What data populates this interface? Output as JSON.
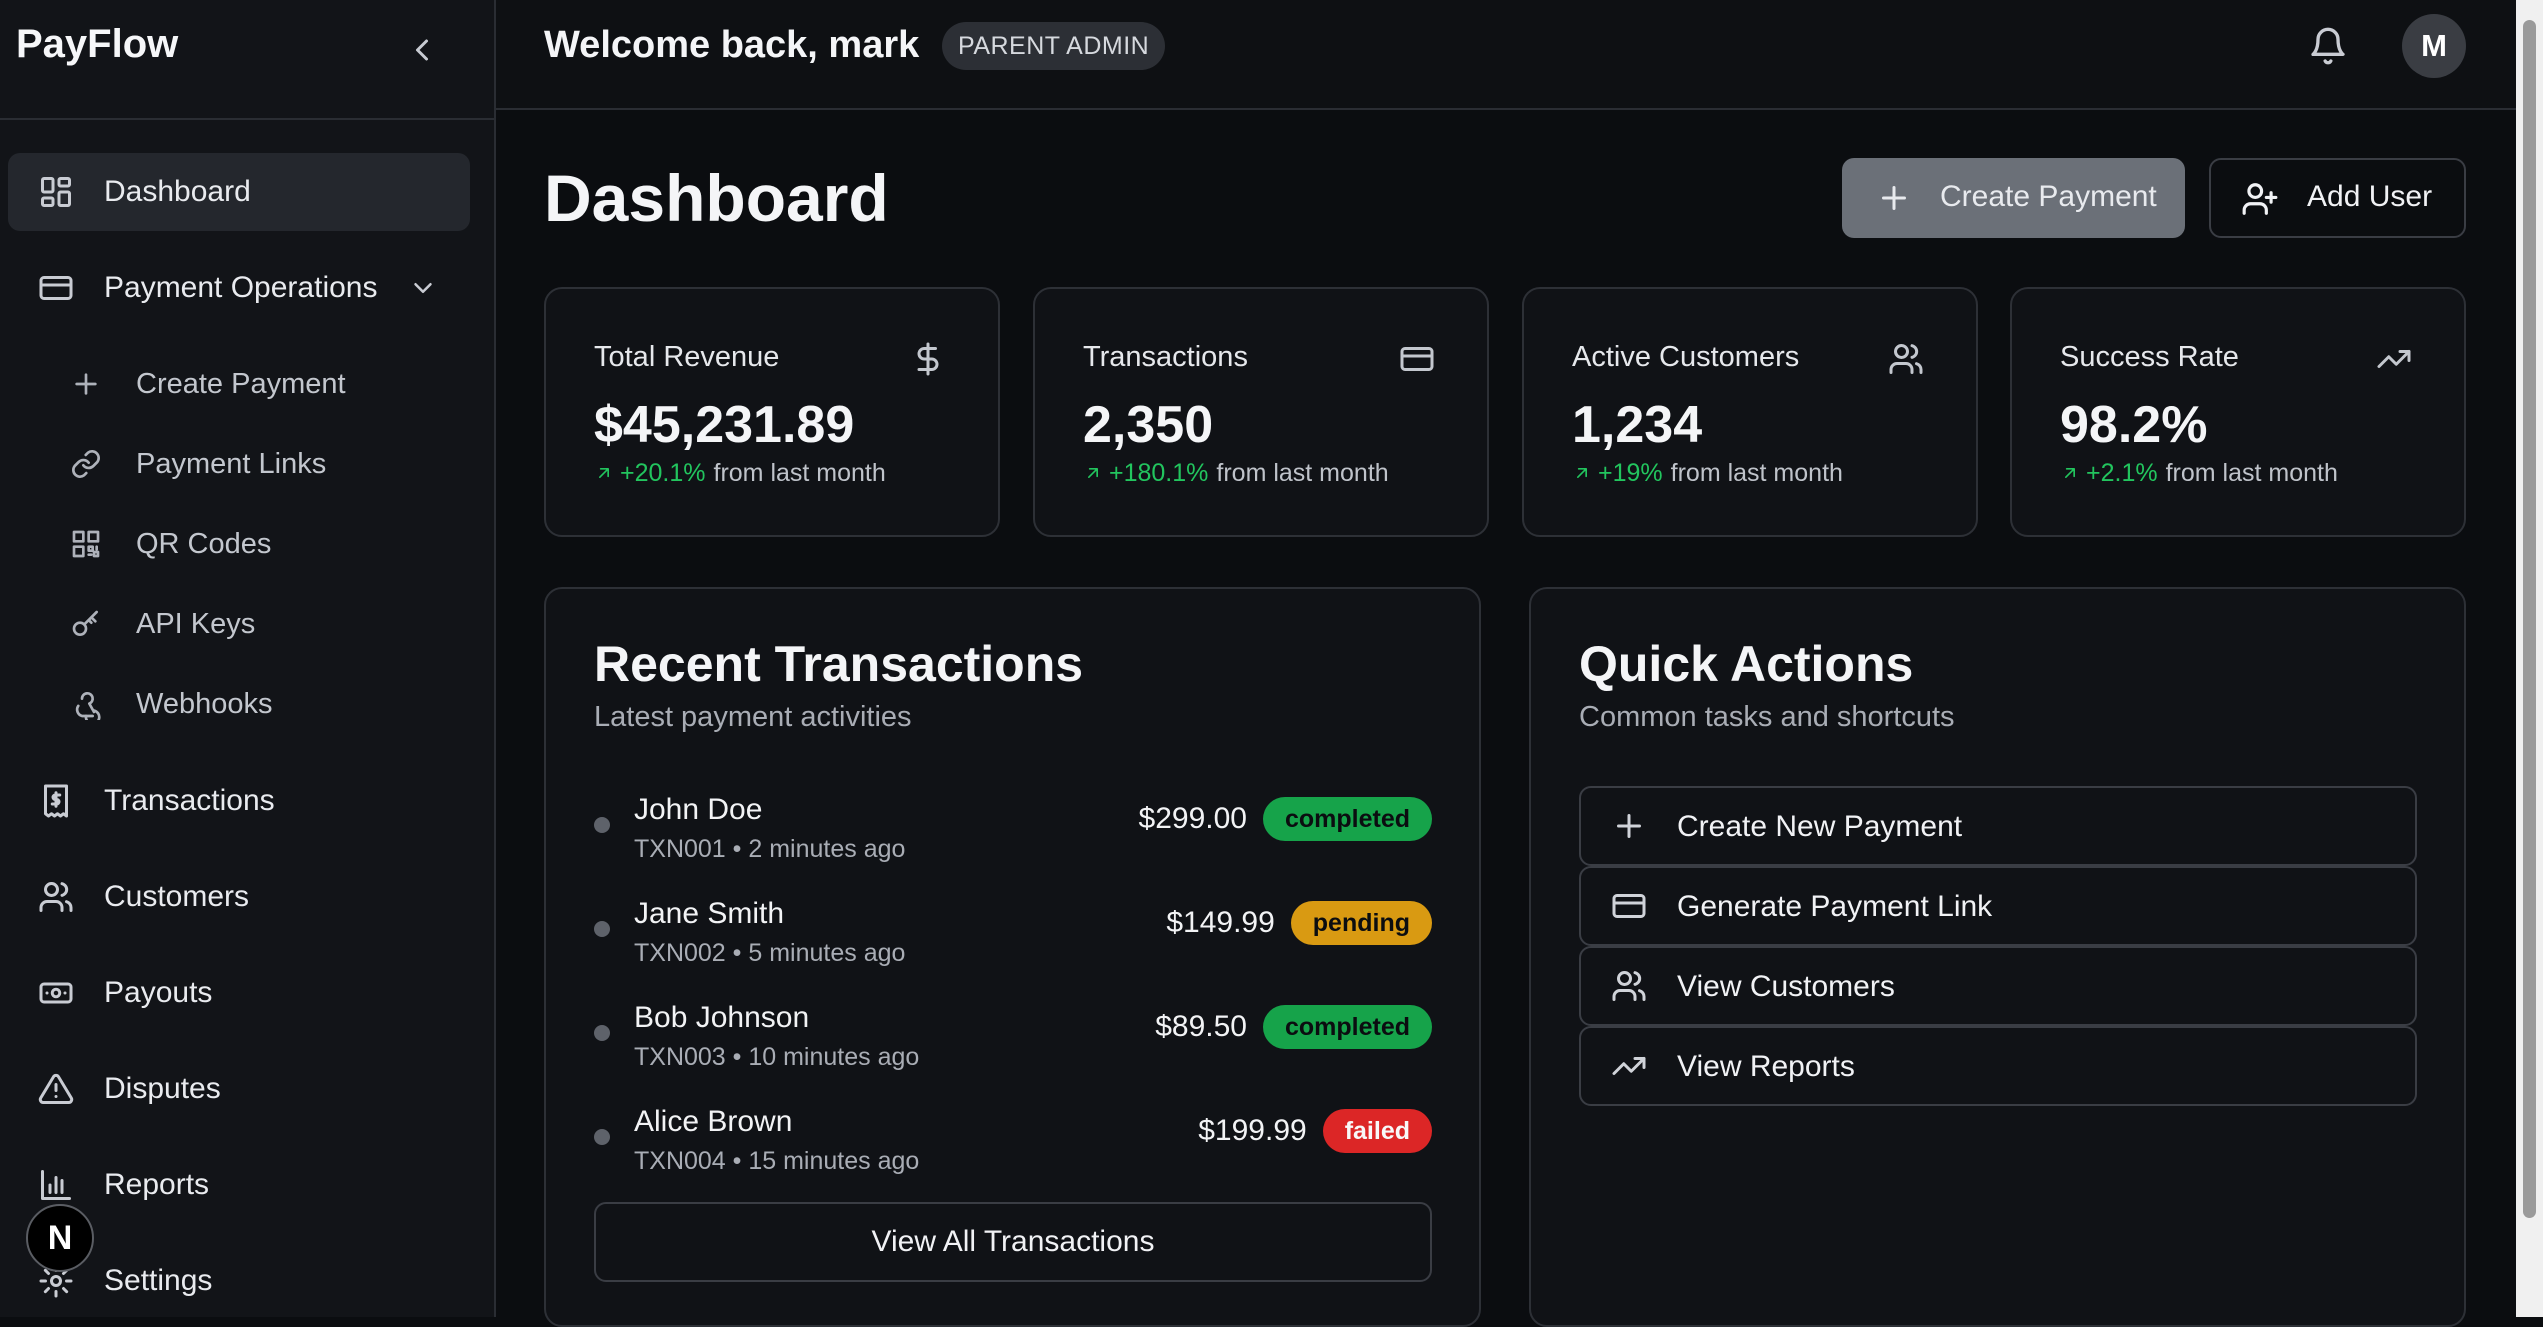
{
  "brand": "PayFlow",
  "sidebar": {
    "items": [
      {
        "label": "Dashboard",
        "icon": "layout-grid-icon"
      },
      {
        "label": "Payment Operations",
        "icon": "credit-card-icon"
      },
      {
        "label": "Transactions",
        "icon": "receipt-icon"
      },
      {
        "label": "Customers",
        "icon": "users-icon"
      },
      {
        "label": "Payouts",
        "icon": "banknote-icon"
      },
      {
        "label": "Disputes",
        "icon": "alert-triangle-icon"
      },
      {
        "label": "Reports",
        "icon": "bar-chart-icon"
      },
      {
        "label": "Settings",
        "icon": "gear-icon"
      }
    ],
    "sub_items": [
      {
        "label": "Create Payment",
        "icon": "plus-icon"
      },
      {
        "label": "Payment Links",
        "icon": "link-icon"
      },
      {
        "label": "QR Codes",
        "icon": "qr-code-icon"
      },
      {
        "label": "API Keys",
        "icon": "key-icon"
      },
      {
        "label": "Webhooks",
        "icon": "webhook-icon"
      }
    ],
    "floating_badge": "N"
  },
  "header": {
    "welcome": "Welcome back, mark",
    "role": "PARENT ADMIN",
    "avatar": "M"
  },
  "main": {
    "title": "Dashboard",
    "create_payment": "Create Payment",
    "add_user": "Add User"
  },
  "stats": [
    {
      "title": "Total Revenue",
      "value": "$45,231.89",
      "change": "+20.1%",
      "suffix": "from last month",
      "icon": "dollar-icon"
    },
    {
      "title": "Transactions",
      "value": "2,350",
      "change": "+180.1%",
      "suffix": "from last month",
      "icon": "credit-card-icon"
    },
    {
      "title": "Active Customers",
      "value": "1,234",
      "change": "+19%",
      "suffix": "from last month",
      "icon": "users-icon"
    },
    {
      "title": "Success Rate",
      "value": "98.2%",
      "change": "+2.1%",
      "suffix": "from last month",
      "icon": "trending-up-icon"
    }
  ],
  "recent": {
    "title": "Recent Transactions",
    "subtitle": "Latest payment activities",
    "rows": [
      {
        "name": "John Doe",
        "meta": "TXN001 • 2 minutes ago",
        "amount": "$299.00",
        "status": "completed"
      },
      {
        "name": "Jane Smith",
        "meta": "TXN002 • 5 minutes ago",
        "amount": "$149.99",
        "status": "pending"
      },
      {
        "name": "Bob Johnson",
        "meta": "TXN003 • 10 minutes ago",
        "amount": "$89.50",
        "status": "completed"
      },
      {
        "name": "Alice Brown",
        "meta": "TXN004 • 15 minutes ago",
        "amount": "$199.99",
        "status": "failed"
      }
    ],
    "view_all": "View All Transactions"
  },
  "quick": {
    "title": "Quick Actions",
    "subtitle": "Common tasks and shortcuts",
    "actions": [
      {
        "label": "Create New Payment",
        "icon": "plus-icon"
      },
      {
        "label": "Generate Payment Link",
        "icon": "credit-card-icon"
      },
      {
        "label": "View Customers",
        "icon": "users-icon"
      },
      {
        "label": "View Reports",
        "icon": "trending-up-icon"
      }
    ]
  },
  "colors": {
    "background": "#0b0d10",
    "positive": "#22c55e",
    "completed": "#16a34a",
    "pending": "#d99a12",
    "failed": "#dc2626"
  }
}
